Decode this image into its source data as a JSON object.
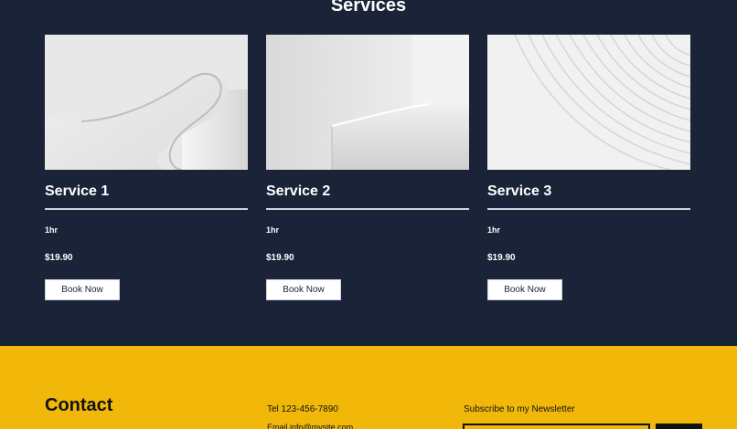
{
  "services": {
    "title": "Services",
    "cards": [
      {
        "title": "Service 1",
        "duration": "1hr",
        "price": "$19.90",
        "button": "Book Now"
      },
      {
        "title": "Service 2",
        "duration": "1hr",
        "price": "$19.90",
        "button": "Book Now"
      },
      {
        "title": "Service 3",
        "duration": "1hr",
        "price": "$19.90",
        "button": "Book Now"
      }
    ]
  },
  "footer": {
    "contact_title": "Contact",
    "tel": "Tel 123-456-7890",
    "email": "Email info@mysite.com",
    "newsletter_label": "Subscribe to my Newsletter",
    "newsletter_placeholder": "",
    "submit_label": ""
  },
  "colors": {
    "services_bg": "#1a2337",
    "footer_bg": "#f1b80a",
    "text_light": "#ffffff",
    "text_dark": "#111111"
  }
}
